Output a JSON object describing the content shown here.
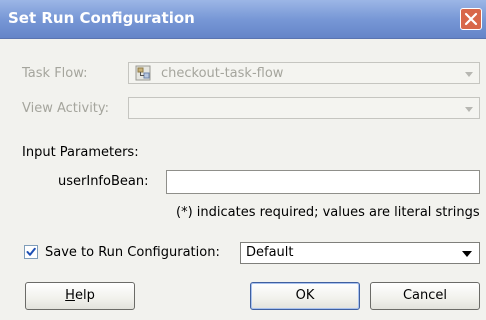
{
  "window": {
    "title": "Set Run Configuration"
  },
  "task_flow": {
    "label": "Task Flow:",
    "value": "checkout-task-flow",
    "icon": "task-flow-icon",
    "enabled": false
  },
  "view_activity": {
    "label": "View Activity:",
    "value": "",
    "enabled": false
  },
  "input_parameters": {
    "heading": "Input Parameters:",
    "params": [
      {
        "label": "userInfoBean:",
        "value": ""
      }
    ],
    "note": "(*) indicates required; values are literal strings"
  },
  "save": {
    "checked": true,
    "label": "Save to Run Configuration:",
    "selected": "Default"
  },
  "buttons": {
    "help_mnemonic": "H",
    "help_rest": "elp",
    "ok": "OK",
    "cancel": "Cancel"
  },
  "colors": {
    "titlebar": "#7898d6",
    "close_button": "#d8674a",
    "dialog_bg": "#f2f2ee",
    "disabled_text": "#a5a59d"
  }
}
